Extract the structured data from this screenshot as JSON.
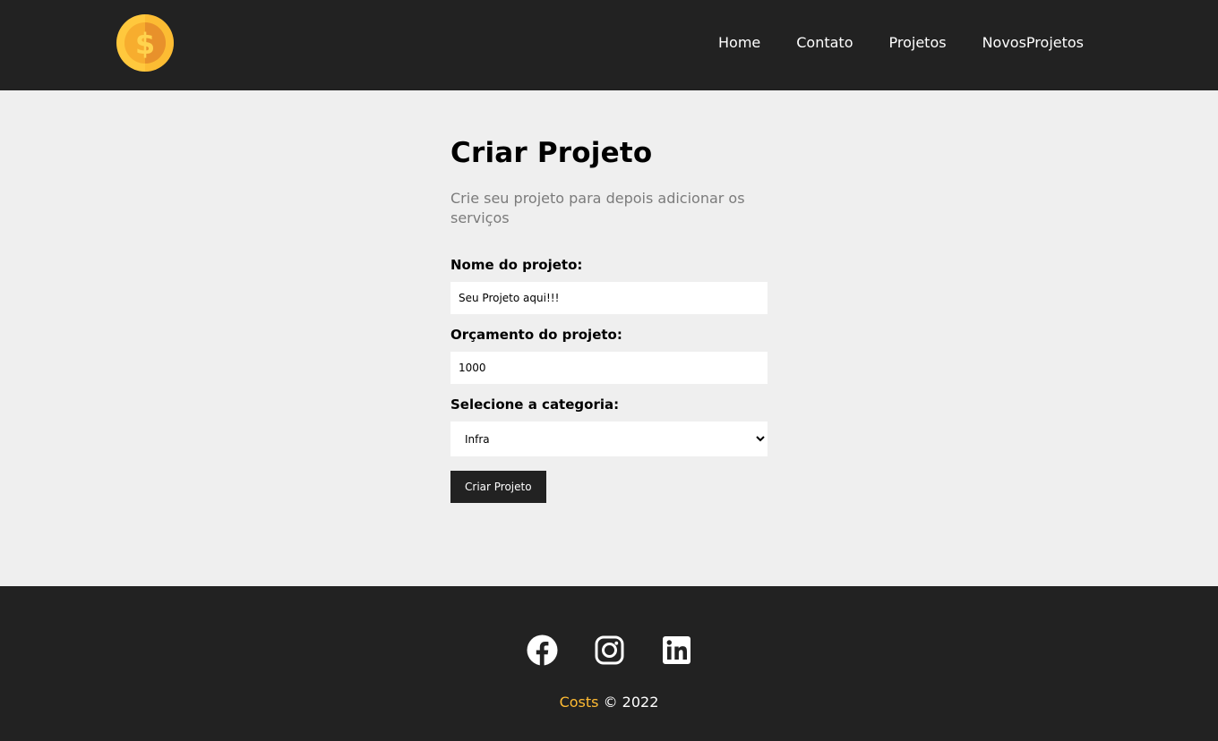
{
  "navbar": {
    "logo_icon": "coin-dollar-icon",
    "links": [
      {
        "label": "Home"
      },
      {
        "label": "Contato"
      },
      {
        "label": "Projetos"
      },
      {
        "label": "NovosProjetos"
      }
    ]
  },
  "page": {
    "title": "Criar Projeto",
    "subtitle": "Crie seu projeto para depois adicionar os serviços"
  },
  "form": {
    "name_label": "Nome do projeto:",
    "name_value": "Seu Projeto aqui!!!",
    "budget_label": "Orçamento do projeto:",
    "budget_value": "1000",
    "category_label": "Selecione a categoria:",
    "category_selected": "Infra",
    "submit_label": "Criar Projeto"
  },
  "footer": {
    "social_icons": [
      "facebook-icon",
      "instagram-icon",
      "linkedin-icon"
    ],
    "brand": "Costs",
    "copyright": "© 2022"
  },
  "colors": {
    "navbar_bg": "#222222",
    "page_bg": "#efefef",
    "accent": "#ffbb33",
    "subtitle": "#7b7b7b"
  }
}
